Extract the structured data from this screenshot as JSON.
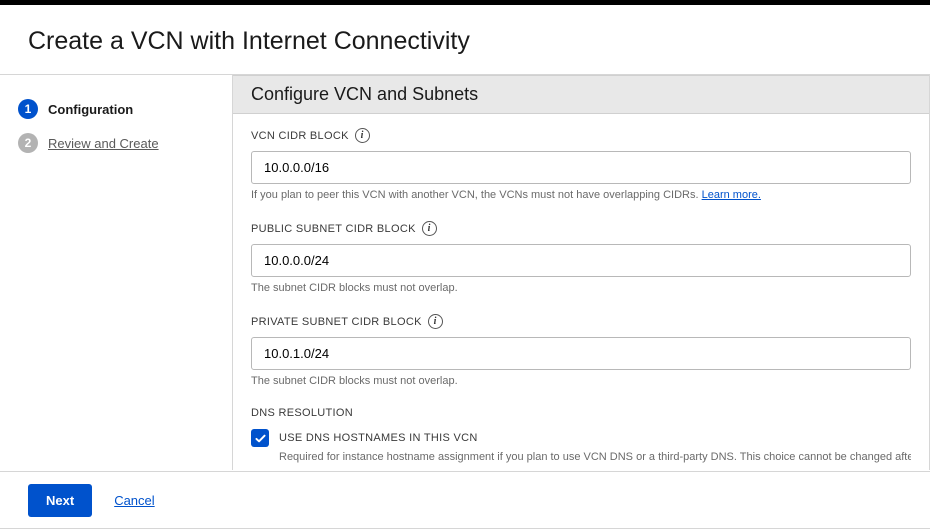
{
  "page_title": "Create a VCN with Internet Connectivity",
  "sidebar": {
    "steps": [
      {
        "num": "1",
        "label": "Configuration",
        "active": true
      },
      {
        "num": "2",
        "label": "Review and Create",
        "active": false
      }
    ]
  },
  "main": {
    "header": "Configure VCN and Subnets",
    "vcn_cidr": {
      "label": "VCN CIDR BLOCK",
      "value": "10.0.0.0/16",
      "help": "If you plan to peer this VCN with another VCN, the VCNs must not have overlapping CIDRs.",
      "learn_more": "Learn more."
    },
    "public_subnet": {
      "label": "PUBLIC SUBNET CIDR BLOCK",
      "value": "10.0.0.0/24",
      "help": "The subnet CIDR blocks must not overlap."
    },
    "private_subnet": {
      "label": "PRIVATE SUBNET CIDR BLOCK",
      "value": "10.0.1.0/24",
      "help": "The subnet CIDR blocks must not overlap."
    },
    "dns": {
      "section_label": "DNS RESOLUTION",
      "checkbox_label": "USE DNS HOSTNAMES IN THIS VCN",
      "help": "Required for instance hostname assignment if you plan to use VCN DNS or a third-party DNS. This choice cannot be changed after the"
    }
  },
  "buttons": {
    "next": "Next",
    "cancel": "Cancel"
  }
}
